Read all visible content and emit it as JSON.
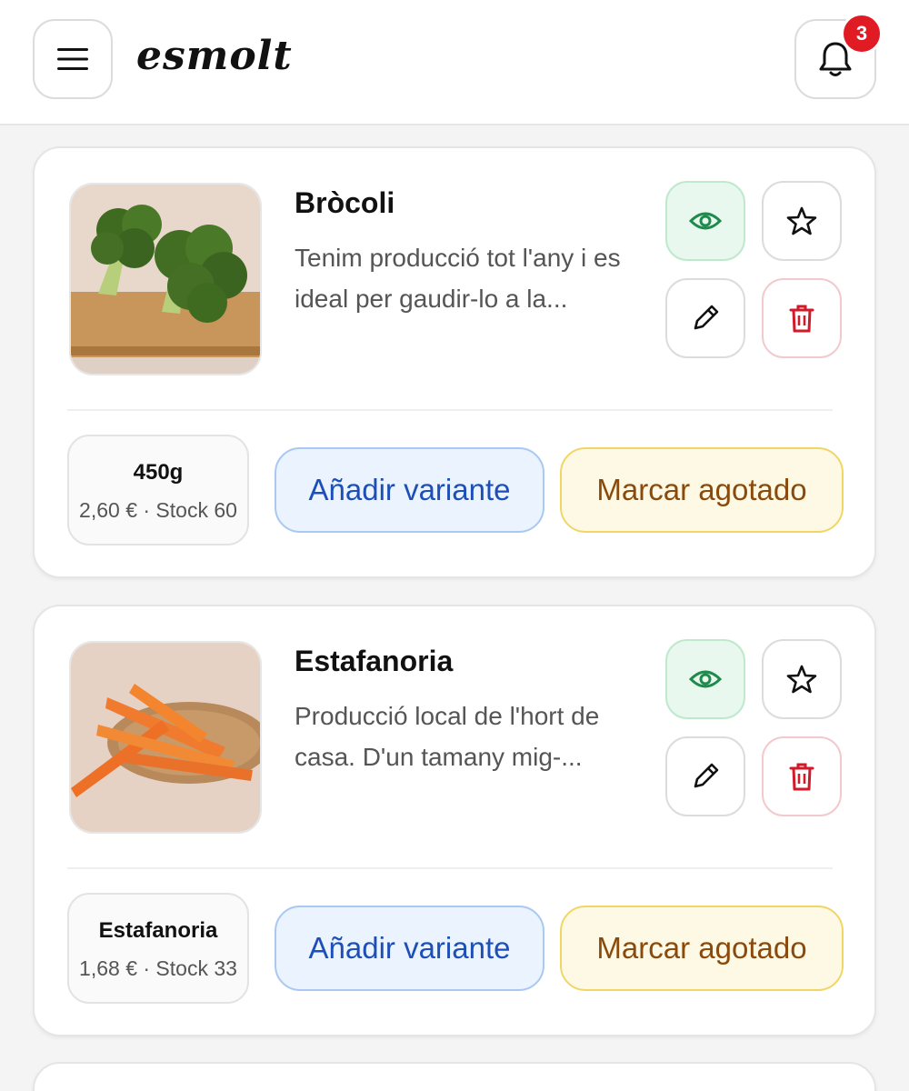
{
  "app": {
    "logo": "esmolt",
    "notifications_count": "3",
    "accent": "#e01b24"
  },
  "products": [
    {
      "title": "Bròcoli",
      "description": "Tenim producció tot l'any i es ideal per gaudir-lo a la...",
      "image_icon": "broccoli-image",
      "variant": {
        "name": "450g",
        "info": "2,60 € · Stock 60"
      },
      "add_variant_label": "Añadir variante",
      "mark_soldout_label": "Marcar agotado"
    },
    {
      "title": "Estafanoria",
      "description": "Producció local de l'hort de casa. D'un tamany mig-...",
      "image_icon": "carrots-image",
      "variant": {
        "name": "Estafanoria",
        "info": "1,68 € · Stock 33"
      },
      "add_variant_label": "Añadir variante",
      "mark_soldout_label": "Marcar agotado"
    }
  ],
  "colors": {
    "view": "#1e8a4c",
    "delete": "#d11a2a",
    "add_variant": "#1d4fb8",
    "mark_soldout": "#8a4a0c"
  }
}
